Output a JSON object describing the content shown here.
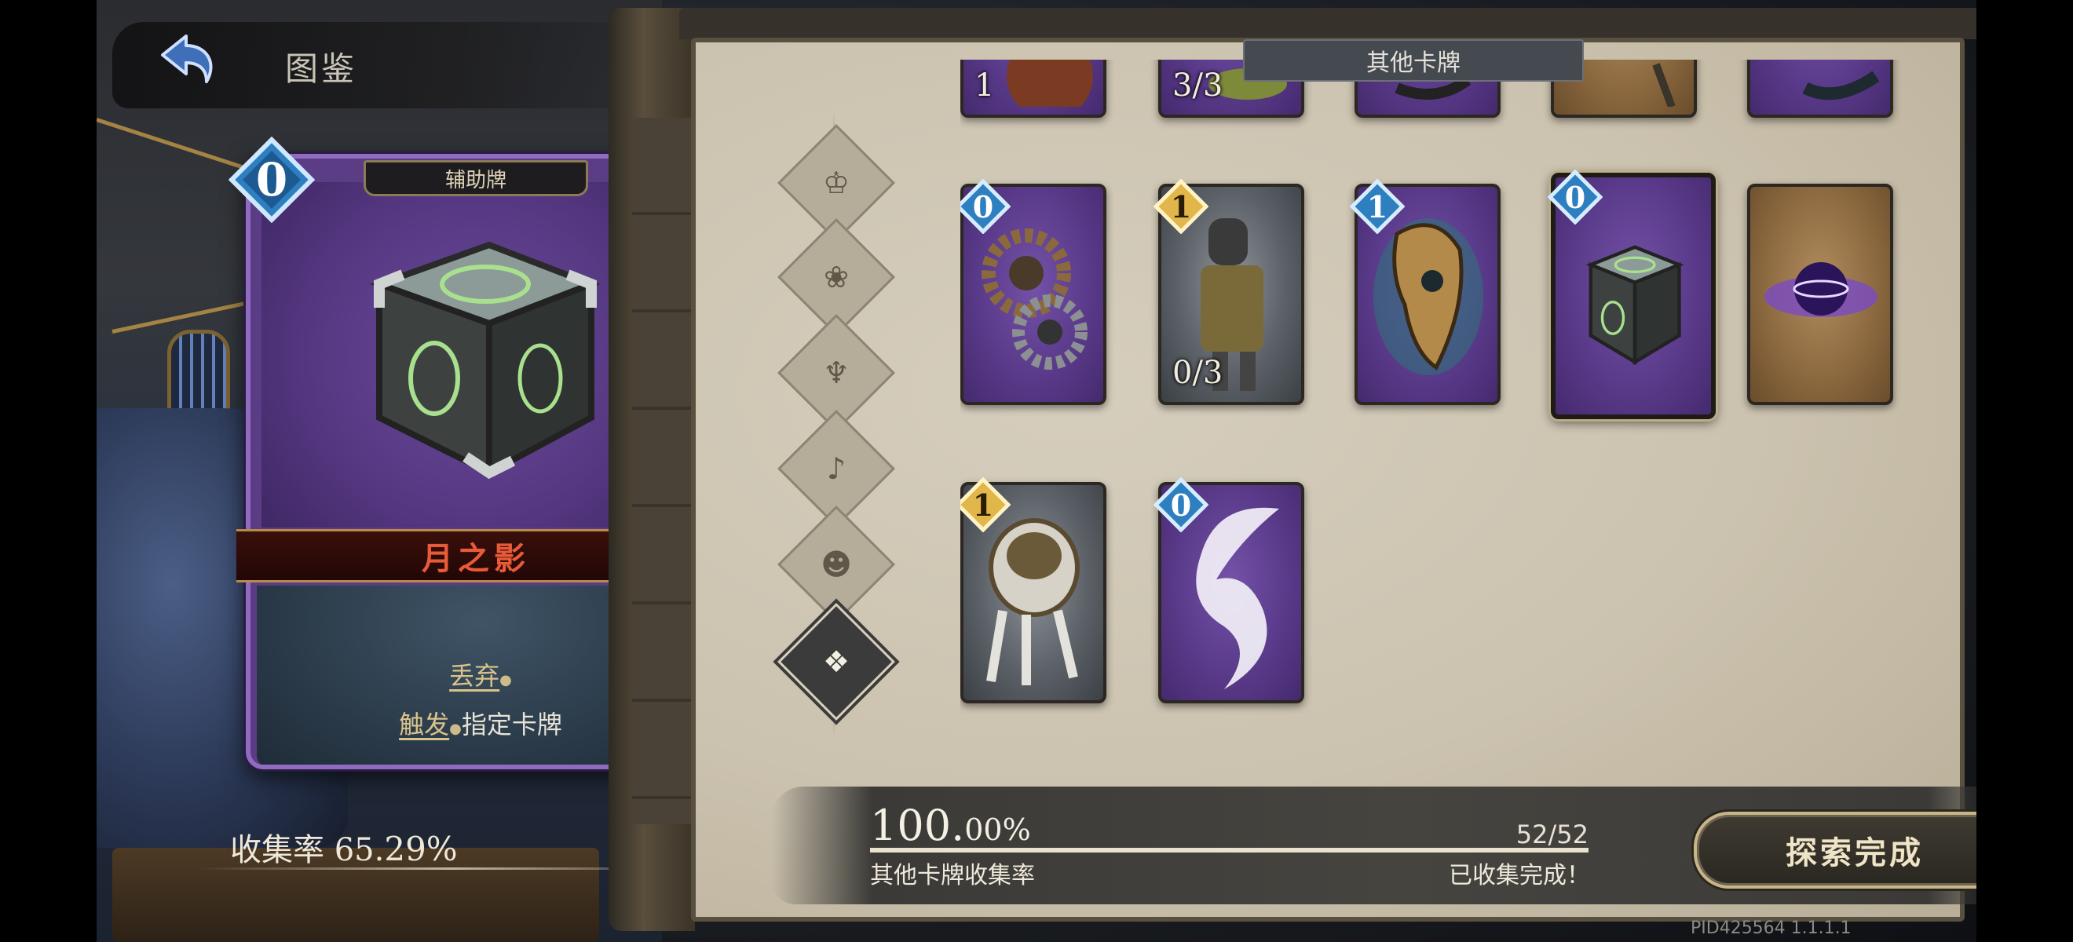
{
  "header": {
    "title": "图鉴",
    "back_icon": "back-arrow-icon"
  },
  "preview_card": {
    "type_label": "辅助牌",
    "cost": "0",
    "name": "月之影",
    "description": [
      {
        "keyword": "丢弃",
        "suffix": ""
      },
      {
        "keyword": "触发",
        "suffix": "指定卡牌"
      }
    ]
  },
  "overall_collection": {
    "label": "收集率",
    "value": "65.",
    "value_small": "29%"
  },
  "section_title": "其他卡牌",
  "filters": [
    {
      "icon": "faction-crown-icon",
      "active": false
    },
    {
      "icon": "faction-rose-icon",
      "active": false
    },
    {
      "icon": "faction-rune-icon",
      "active": false
    },
    {
      "icon": "faction-clef-icon",
      "active": false
    },
    {
      "icon": "faction-mask-icon",
      "active": false
    },
    {
      "icon": "faction-other-icon",
      "active": true
    }
  ],
  "cards_top_partial": [
    {
      "frame": "purple",
      "count": "1",
      "art": "orb"
    },
    {
      "frame": "purple",
      "count": "3/3",
      "art": "creature"
    },
    {
      "frame": "purple",
      "count": "",
      "art": "dark"
    },
    {
      "frame": "brown",
      "count": "",
      "art": "staff"
    },
    {
      "frame": "purple",
      "count": "",
      "art": "dark"
    }
  ],
  "cards": [
    {
      "frame": "purple",
      "cost": "0",
      "gem": "blue",
      "count": "",
      "art": "gears",
      "selected": false
    },
    {
      "frame": "gray",
      "cost": "1",
      "gem": "gold",
      "count": "0/3",
      "art": "knight",
      "selected": false
    },
    {
      "frame": "purple",
      "cost": "1",
      "gem": "blue",
      "count": "",
      "art": "mask",
      "selected": false
    },
    {
      "frame": "purple",
      "cost": "0",
      "gem": "blue",
      "count": "",
      "art": "cube",
      "selected": true
    },
    {
      "frame": "brown",
      "cost": "",
      "gem": "",
      "count": "",
      "art": "vortex",
      "selected": false
    },
    {
      "frame": "gray",
      "cost": "1",
      "gem": "gold",
      "count": "",
      "art": "robot",
      "selected": false
    },
    {
      "frame": "purple",
      "cost": "0",
      "gem": "blue",
      "count": "",
      "art": "wisp",
      "selected": false
    }
  ],
  "category_collection": {
    "percent_main": "100.",
    "percent_small": "00%",
    "progress": 1.0,
    "count": "52/52",
    "label": "其他卡牌收集率",
    "status": "已收集完成！"
  },
  "explore_button": "探索完成",
  "version": "PID425564  1.1.1.1",
  "colors": {
    "purple_frame": "#5a3a8a",
    "gold_gem": "#e1b64a",
    "blue_gem": "#2e7fc0",
    "name_red": "#e85a38"
  }
}
